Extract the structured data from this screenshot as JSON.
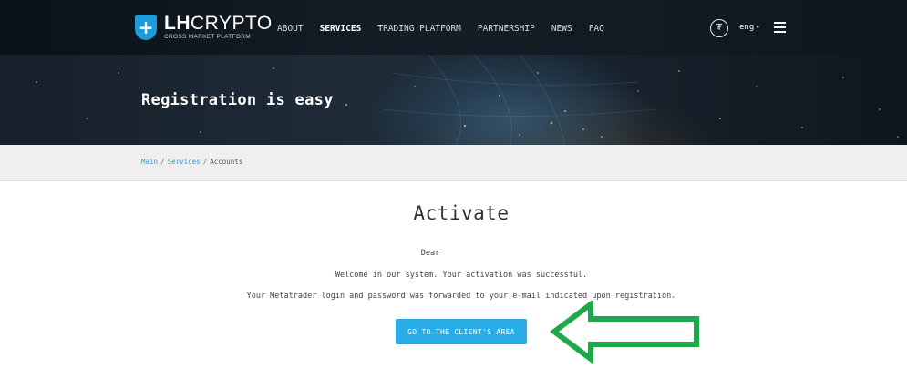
{
  "header": {
    "logo_main": "LH",
    "logo_crypto": "CRYPTO",
    "logo_sub": "CROSS MARKET PLATFORM",
    "nav": [
      {
        "label": "ABOUT",
        "active": false
      },
      {
        "label": "SERVICES",
        "active": true
      },
      {
        "label": "TRADING PLATFORM",
        "active": false
      },
      {
        "label": "PARTNERSHIP",
        "active": false
      },
      {
        "label": "NEWS",
        "active": false
      },
      {
        "label": "FAQ",
        "active": false
      }
    ],
    "coin_glyph": "₮",
    "language": "eng",
    "language_caret": "▾"
  },
  "hero": {
    "title": "Registration is easy"
  },
  "breadcrumb": {
    "items": [
      "Main",
      "Services"
    ],
    "separator": "/",
    "current": "Accounts"
  },
  "content": {
    "title": "Activate",
    "dear": "Dear",
    "welcome": "Welcome in our system. Your activation was successful.",
    "forwarded": "Your Metatrader login and password was forwarded to your e-mail indicated upon registration.",
    "cta_label": "GO TO THE CLIENT'S AREA"
  },
  "colors": {
    "accent": "#2aace6",
    "link": "#2a9fd6",
    "annotation_arrow": "#1fa84a",
    "header_bg": "#111a22"
  },
  "icons": {
    "logo": "shield-plus-icon",
    "coin": "tether-coin-icon",
    "menu": "hamburger-menu-icon",
    "annotation": "left-arrow-icon"
  }
}
